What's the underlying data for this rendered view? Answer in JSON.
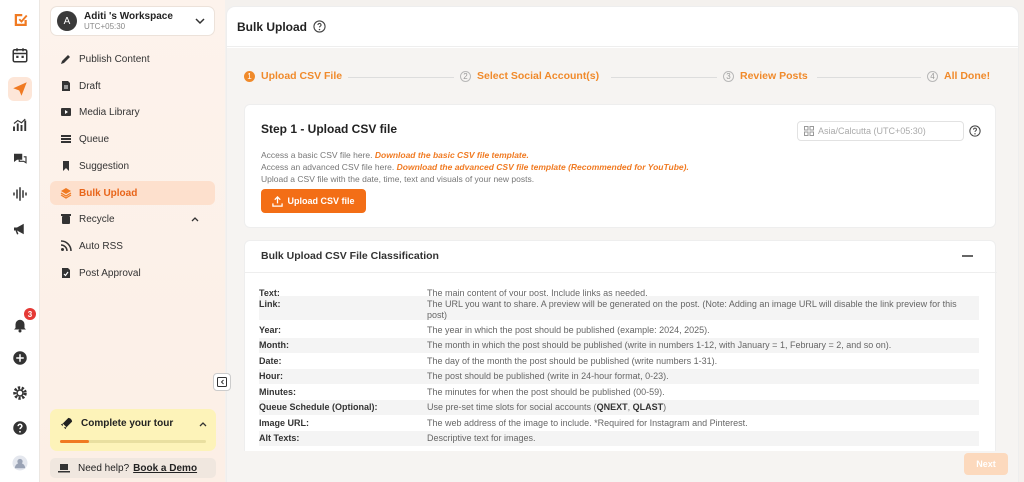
{
  "workspace": {
    "initial": "A",
    "name": "Aditi 's Workspace",
    "timezone": "UTC+05:30"
  },
  "nav": [
    {
      "label": "Publish Content",
      "icon": "pencil-icon"
    },
    {
      "label": "Draft",
      "icon": "draft-icon"
    },
    {
      "label": "Media Library",
      "icon": "media-icon"
    },
    {
      "label": "Queue",
      "icon": "queue-icon"
    },
    {
      "label": "Suggestion",
      "icon": "bookmark-icon"
    },
    {
      "label": "Bulk Upload",
      "icon": "layers-icon",
      "active": true
    },
    {
      "label": "Recycle",
      "icon": "recycle-icon"
    },
    {
      "label": "Auto RSS",
      "icon": "rss-icon"
    },
    {
      "label": "Post Approval",
      "icon": "approval-icon"
    }
  ],
  "rail": {
    "notification_count": "3"
  },
  "tour": {
    "title": "Complete your tour",
    "progress": 0.2
  },
  "help": {
    "text": "Need help?",
    "link": "Book a Demo"
  },
  "page": {
    "title": "Bulk Upload"
  },
  "steps": [
    {
      "num": "1",
      "label": "Upload CSV File"
    },
    {
      "num": "2",
      "label": "Select Social Account(s)"
    },
    {
      "num": "3",
      "label": "Review Posts"
    },
    {
      "num": "4",
      "label": "All Done!"
    }
  ],
  "step1": {
    "title": "Step 1 - Upload CSV file",
    "basic_text": "Access a basic CSV file here.",
    "basic_link": "Download the basic CSV file template.",
    "advanced_text": "Access an advanced CSV file here.",
    "advanced_link": "Download the advanced CSV file template (Recommended for YouTube).",
    "instruction": "Upload a CSV file with the date, time, text and visuals of your new posts.",
    "upload_label": "Upload CSV file",
    "timezone_placeholder": "Asia/Calcutta (UTC+05:30)"
  },
  "classification": {
    "title": "Bulk Upload CSV File Classification",
    "rows": [
      {
        "key": "Text:",
        "value": "The main content of your post. Include links as needed."
      },
      {
        "key": "Link:",
        "value": "The URL you want to share. A preview will be generated on the post. (Note: Adding an image URL will disable the link preview for this post)"
      },
      {
        "key": "Year:",
        "value": "The year in which the post should be published (example: 2024, 2025)."
      },
      {
        "key": "Month:",
        "value": "The month in which the post should be published (write in numbers 1-12, with January = 1, February = 2, and so on)."
      },
      {
        "key": "Date:",
        "value": "The day of the month the post should be published (write numbers 1-31)."
      },
      {
        "key": "Hour:",
        "value": "The post should be published (write in 24-hour format, 0-23)."
      },
      {
        "key": "Minutes:",
        "value": "The minutes for when the post should be published (00-59)."
      },
      {
        "key": "Queue Schedule (Optional):",
        "value_prefix": "Use pre-set time slots for social accounts (",
        "value_bold1": "QNEXT",
        "value_sep": ", ",
        "value_bold2": "QLAST",
        "value_suffix": ")"
      },
      {
        "key": "Image URL:",
        "value": "The web address of the image to include. *Required for Instagram and Pinterest."
      },
      {
        "key": "Alt Texts:",
        "value": "Descriptive text for images."
      }
    ]
  },
  "footer": {
    "next_label": "Next"
  }
}
